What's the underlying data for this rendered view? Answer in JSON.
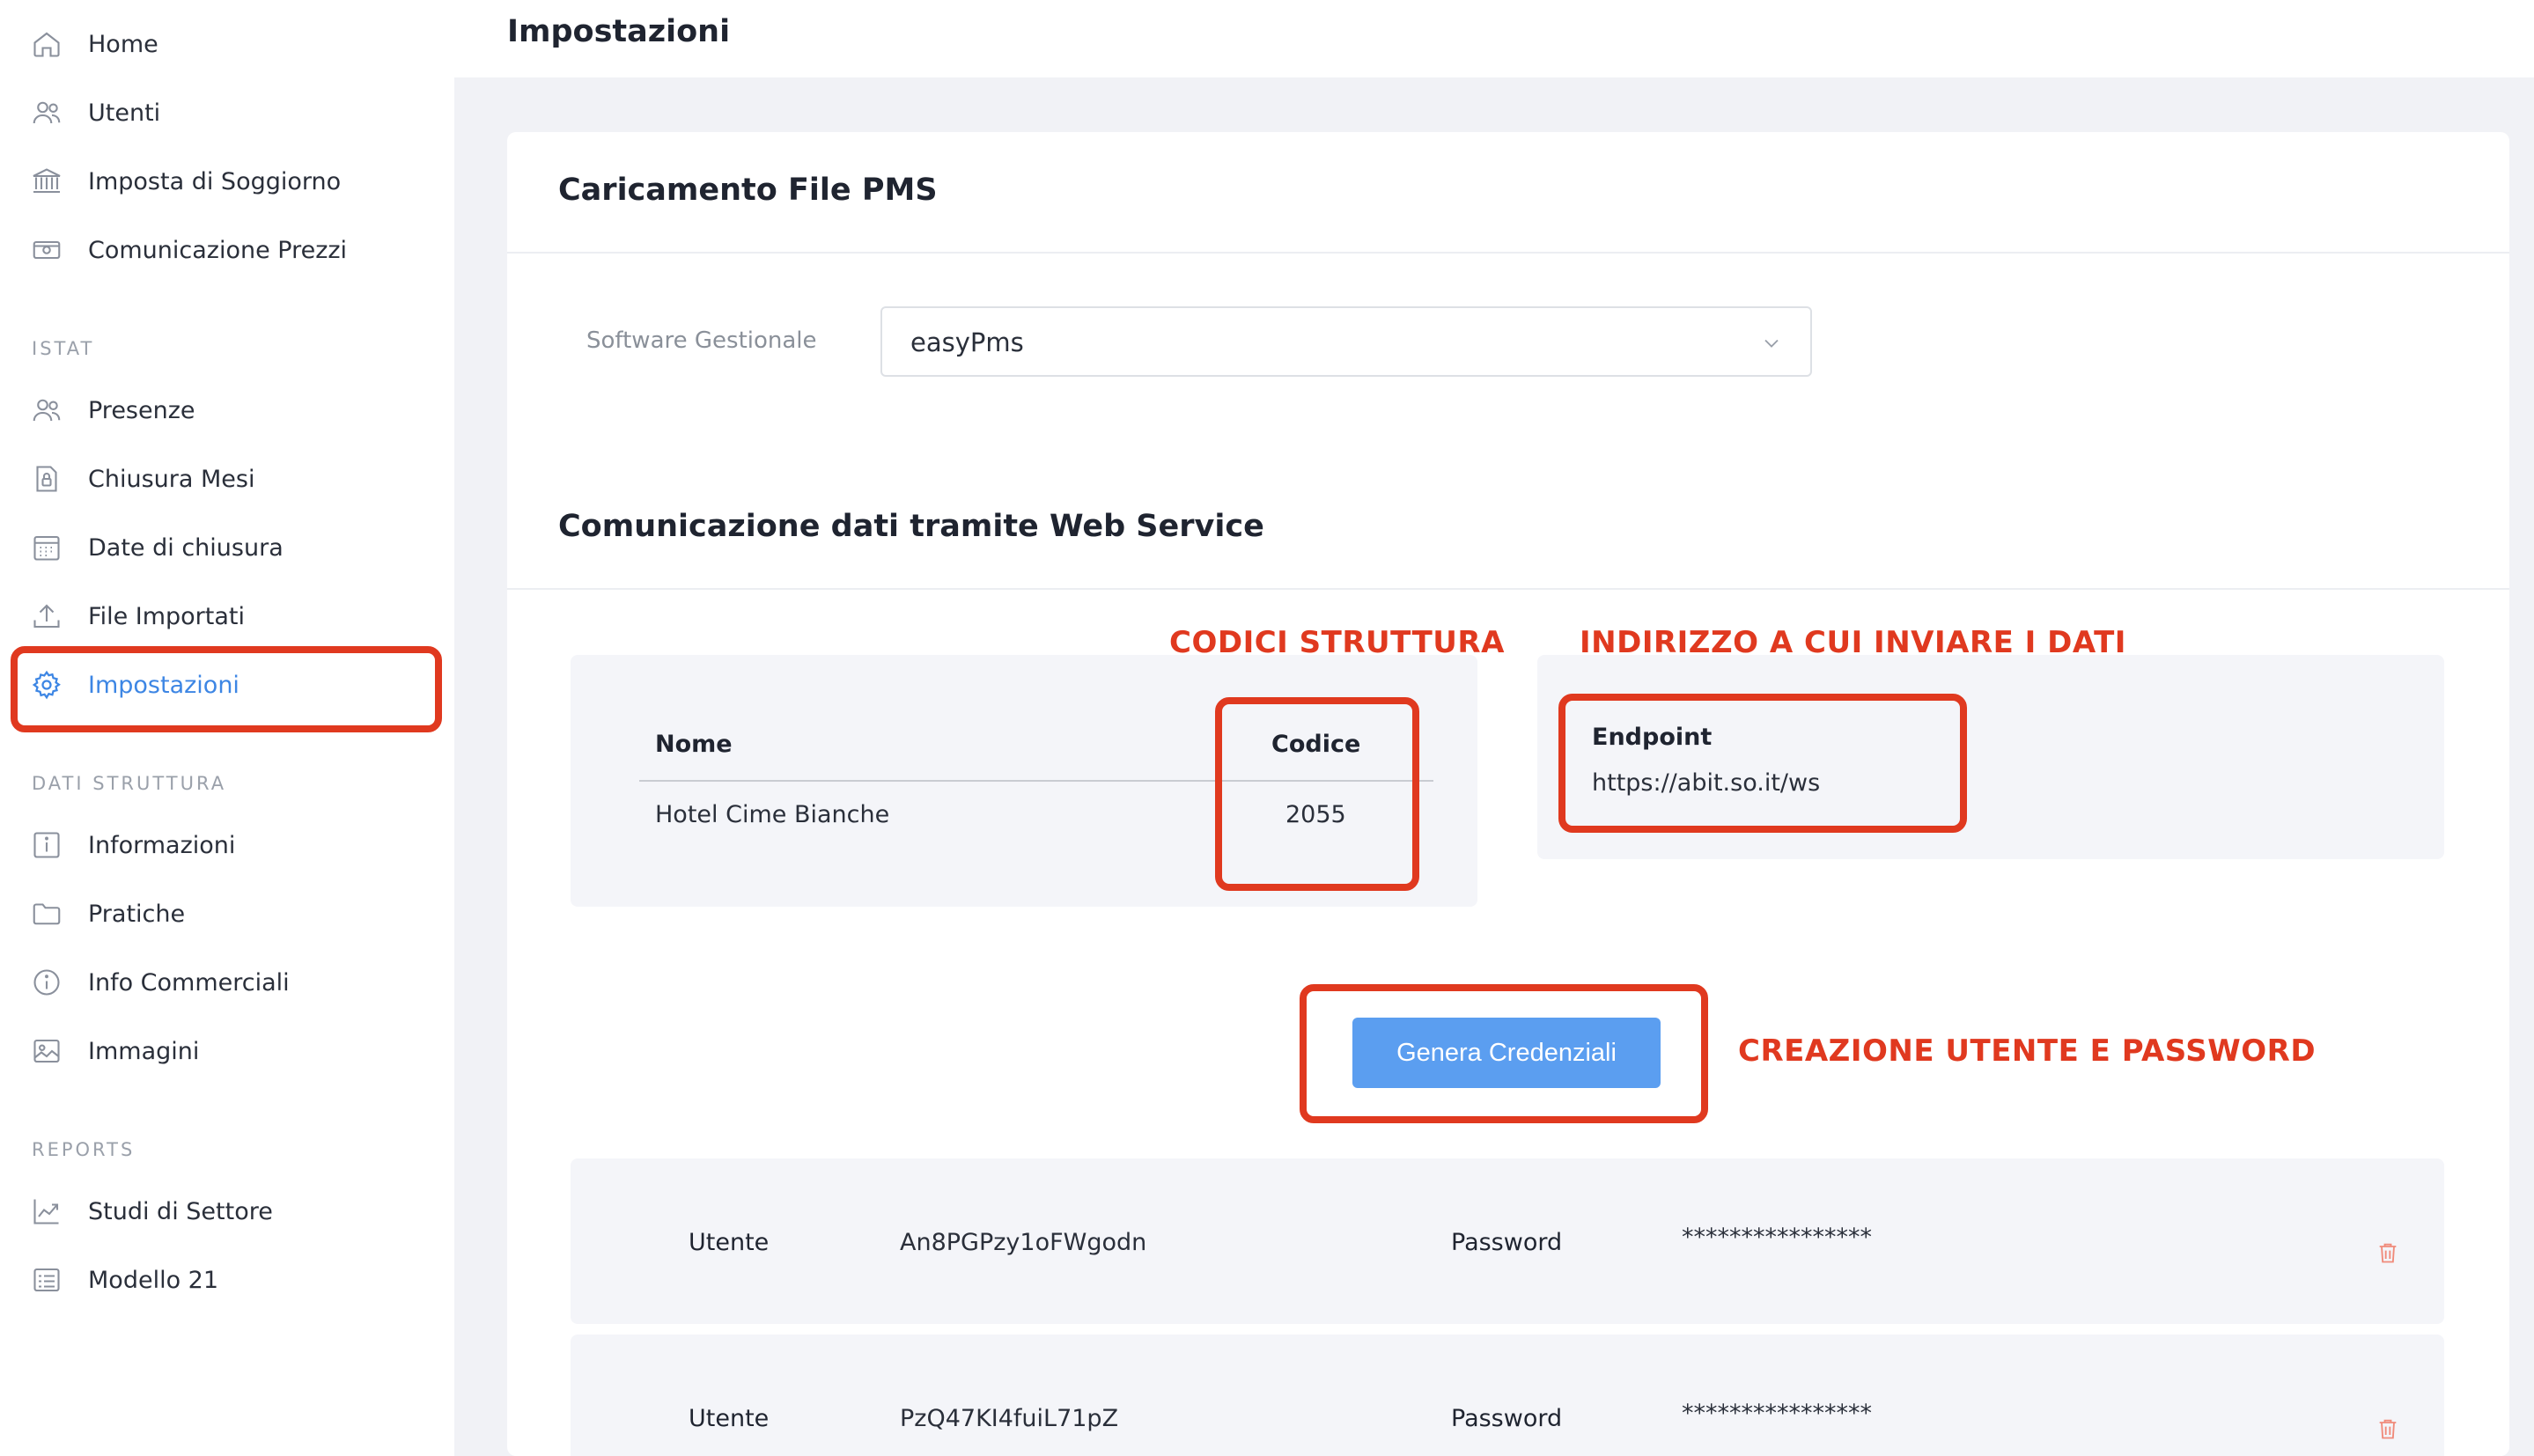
{
  "sidebar": {
    "items_main": [
      {
        "label": "Home",
        "icon": "home-icon"
      },
      {
        "label": "Utenti",
        "icon": "users-icon"
      },
      {
        "label": "Imposta di Soggiorno",
        "icon": "bank-icon"
      },
      {
        "label": "Comunicazione Prezzi",
        "icon": "money-icon"
      }
    ],
    "section_istat": "ISTAT",
    "items_istat": [
      {
        "label": "Presenze",
        "icon": "users-icon"
      },
      {
        "label": "Chiusura Mesi",
        "icon": "lock-icon"
      },
      {
        "label": "Date di chiusura",
        "icon": "calendar-icon"
      },
      {
        "label": "File Importati",
        "icon": "upload-icon"
      },
      {
        "label": "Impostazioni",
        "icon": "gear-icon",
        "active": true
      }
    ],
    "section_dati": "DATI STRUTTURA",
    "items_dati": [
      {
        "label": "Informazioni",
        "icon": "info-square-icon"
      },
      {
        "label": "Pratiche",
        "icon": "folder-icon"
      },
      {
        "label": "Info Commerciali",
        "icon": "info-circle-icon"
      },
      {
        "label": "Immagini",
        "icon": "image-icon"
      }
    ],
    "section_reports": "REPORTS",
    "items_reports": [
      {
        "label": "Studi di Settore",
        "icon": "chart-icon"
      },
      {
        "label": "Modello 21",
        "icon": "form-icon"
      }
    ]
  },
  "header": {
    "title": "Impostazioni"
  },
  "pms": {
    "title": "Caricamento File PMS",
    "field_label": "Software Gestionale",
    "selected": "easyPms"
  },
  "webservice": {
    "title": "Comunicazione dati tramite Web Service",
    "table": {
      "headers": [
        "Nome",
        "Codice"
      ],
      "rows": [
        {
          "nome": "Hotel Cime Bianche",
          "codice": "2055"
        }
      ]
    },
    "endpoint_label": "Endpoint",
    "endpoint_value": "https://abit.so.it/ws",
    "generate_button": "Genera Credenziali",
    "credentials": [
      {
        "user_label": "Utente",
        "user": "An8PGPzy1oFWgodn",
        "pass_label": "Password",
        "pass": "****************"
      },
      {
        "user_label": "Utente",
        "user": "PzQ47KI4fuiL71pZ",
        "pass_label": "Password",
        "pass": "****************"
      }
    ]
  },
  "annotations": {
    "codici": "CODICI STRUTTURA",
    "indirizzo": "INDIRIZZO A CUI INVIARE I DATI",
    "creazione": "CREAZIONE UTENTE E PASSWORD"
  },
  "colors": {
    "accent": "#3d86e4",
    "annotation": "#e0391f",
    "button": "#5b9ef0"
  }
}
